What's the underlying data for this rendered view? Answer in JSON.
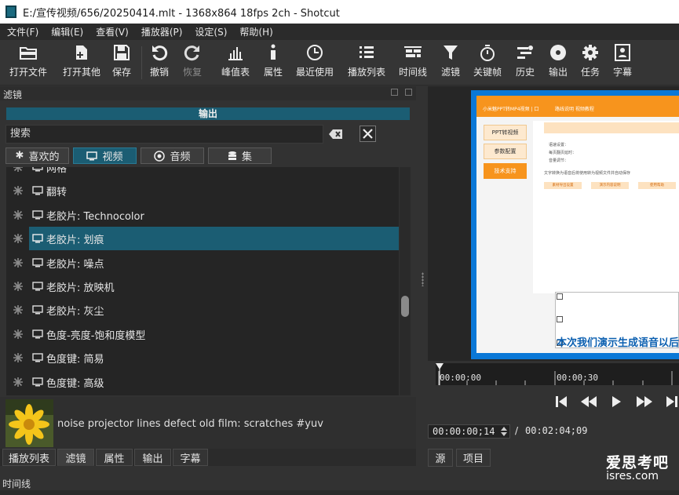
{
  "window": {
    "title": "E:/宣传视频/656/20250414.mlt - 1368x864 18fps 2ch - Shotcut"
  },
  "menu": [
    "文件(F)",
    "编辑(E)",
    "查看(V)",
    "播放器(P)",
    "设定(S)",
    "帮助(H)"
  ],
  "toolbar": {
    "open_file": "打开文件",
    "open_other": "打开其他",
    "save": "保存",
    "undo": "撤销",
    "redo": "恢复",
    "peak_meter": "峰值表",
    "properties": "属性",
    "recent": "最近使用",
    "playlist": "播放列表",
    "timeline": "时间线",
    "filters": "滤镜",
    "keyframes": "关键帧",
    "history": "历史",
    "export": "输出",
    "jobs": "任务",
    "subtitles": "字幕"
  },
  "filters_panel": {
    "title": "滤镜",
    "output_label": "输出",
    "search_value": "搜索",
    "tabs": {
      "favorites": "喜欢的",
      "video": "视频",
      "audio": "音频",
      "sets": "集"
    },
    "items": [
      {
        "name": "网格"
      },
      {
        "name": "翻转"
      },
      {
        "name": "老胶片: Technocolor"
      },
      {
        "name": "老胶片: 划痕"
      },
      {
        "name": "老胶片: 噪点"
      },
      {
        "name": "老胶片: 放映机"
      },
      {
        "name": "老胶片: 灰尘"
      },
      {
        "name": "色度-亮度-饱和度模型"
      },
      {
        "name": "色度键: 简易"
      },
      {
        "name": "色度键: 高级"
      }
    ],
    "selected_index": 3,
    "description": "noise projector lines defect old film: scratches #yuv"
  },
  "left_tabs": [
    "播放列表",
    "滤镜",
    "属性",
    "输出",
    "字幕"
  ],
  "left_active_tab": "滤镜",
  "timeline_title": "时间线",
  "preview": {
    "frame": {
      "header": "小米魅PPT转MP4视频 | 口",
      "header_links": "路线说明  视频教程",
      "side_buttons": [
        "PPT转视频",
        "参数配置",
        "技术支持"
      ],
      "form_lines": [
        "语速设置：",
        "每页翻页延时：",
        "音量调节："
      ],
      "note": "文字转换为语音后将使用转为视频文件并自动保存",
      "action_buttons": [
        "素材导出设置",
        "演示内容说明",
        "使用帮助"
      ],
      "subtitle": "本次我们演示生成语音以后"
    }
  },
  "ruler": {
    "t0": "00:00:00",
    "t1": "00:00:30"
  },
  "playback": {
    "timecode": "00:00:00;14",
    "separator": "/",
    "duration": "00:02:04;09"
  },
  "right_tabs": [
    "源",
    "项目"
  ],
  "watermark": {
    "line1": "爱思考吧",
    "line2": "isres.com"
  },
  "colors": {
    "accent": "#1b5d73",
    "background": "#323232",
    "list_bg": "#252525",
    "orange": "#f7941d",
    "preview_blue": "#0a78d7"
  }
}
